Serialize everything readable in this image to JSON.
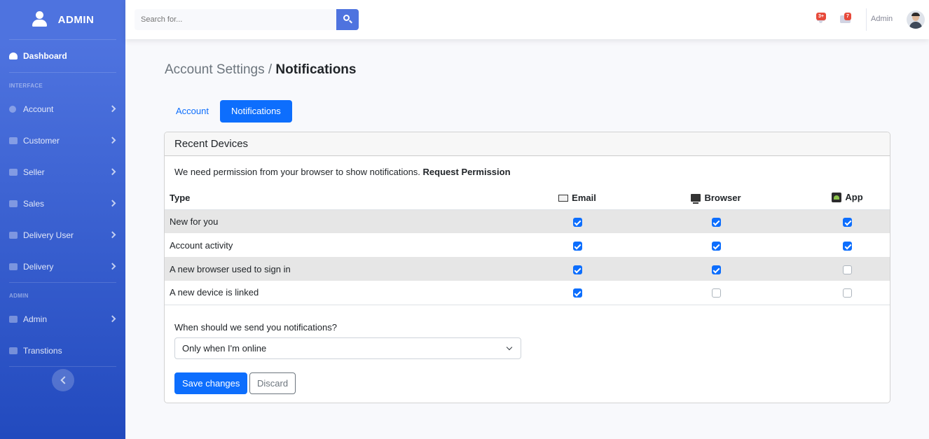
{
  "brand": {
    "title": "ADMIN"
  },
  "sidebar": {
    "dashboard": "Dashboard",
    "heading_interface": "INTERFACE",
    "items_interface": [
      {
        "label": "Account",
        "icon": "gear-icon"
      },
      {
        "label": "Customer",
        "icon": "briefcase-icon"
      },
      {
        "label": "Seller",
        "icon": "briefcase-icon"
      },
      {
        "label": "Sales",
        "icon": "briefcase-icon"
      },
      {
        "label": "Delivery User",
        "icon": "briefcase-icon"
      },
      {
        "label": "Delivery",
        "icon": "briefcase-icon"
      }
    ],
    "heading_admin": "ADMIN",
    "items_admin": [
      {
        "label": "Admin",
        "icon": "folder-icon"
      },
      {
        "label": "Transtions",
        "icon": "table-icon"
      }
    ]
  },
  "topbar": {
    "search_placeholder": "Search for...",
    "alerts_badge": "3+",
    "messages_badge": "7",
    "user_name": "Admin"
  },
  "page": {
    "title_prefix": "Account Settings / ",
    "title_current": "Notifications"
  },
  "tabs": [
    {
      "label": "Account",
      "active": false
    },
    {
      "label": "Notifications",
      "active": true
    }
  ],
  "card": {
    "header": "Recent Devices",
    "permission_text": "We need permission from your browser to show notifications.",
    "permission_link": "Request Permission",
    "columns": {
      "type": "Type",
      "email": "Email",
      "browser": "Browser",
      "app": "App"
    },
    "rows": [
      {
        "type": "New for you",
        "email": true,
        "browser": true,
        "app": true
      },
      {
        "type": "Account activity",
        "email": true,
        "browser": true,
        "app": true
      },
      {
        "type": "A new browser used to sign in",
        "email": true,
        "browser": true,
        "app": false
      },
      {
        "type": "A new device is linked",
        "email": true,
        "browser": false,
        "app": false
      }
    ],
    "when_label": "When should we send you notifications?",
    "when_selected": "Only when I'm online",
    "save_label": "Save changes",
    "discard_label": "Discard"
  },
  "colors": {
    "primary": "#0d6efd",
    "sidebar": "#4e73df",
    "badge": "#e74a3b"
  }
}
